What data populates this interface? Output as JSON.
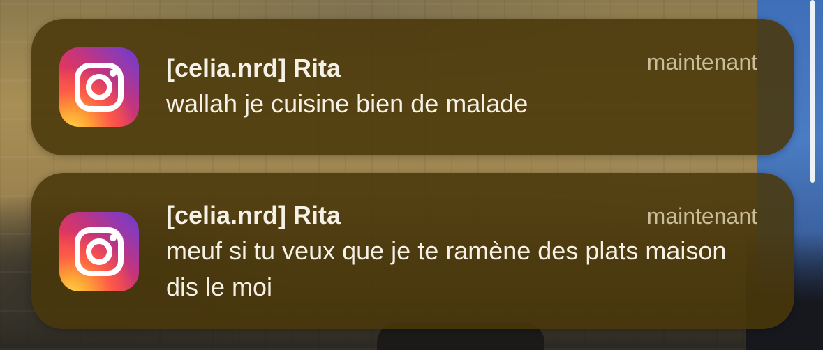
{
  "background": {
    "accent_wall": "#a88f55",
    "sky": "#4a7cc4"
  },
  "notifications": [
    {
      "app_icon": "instagram-icon",
      "title": "[celia.nrd] Rita",
      "time": "maintenant",
      "body": "wallah je cuisine bien de malade"
    },
    {
      "app_icon": "instagram-icon",
      "title": "[celia.nrd] Rita",
      "time": "maintenant",
      "body": "meuf si tu veux que je te ramène des plats maison dis le moi"
    }
  ]
}
